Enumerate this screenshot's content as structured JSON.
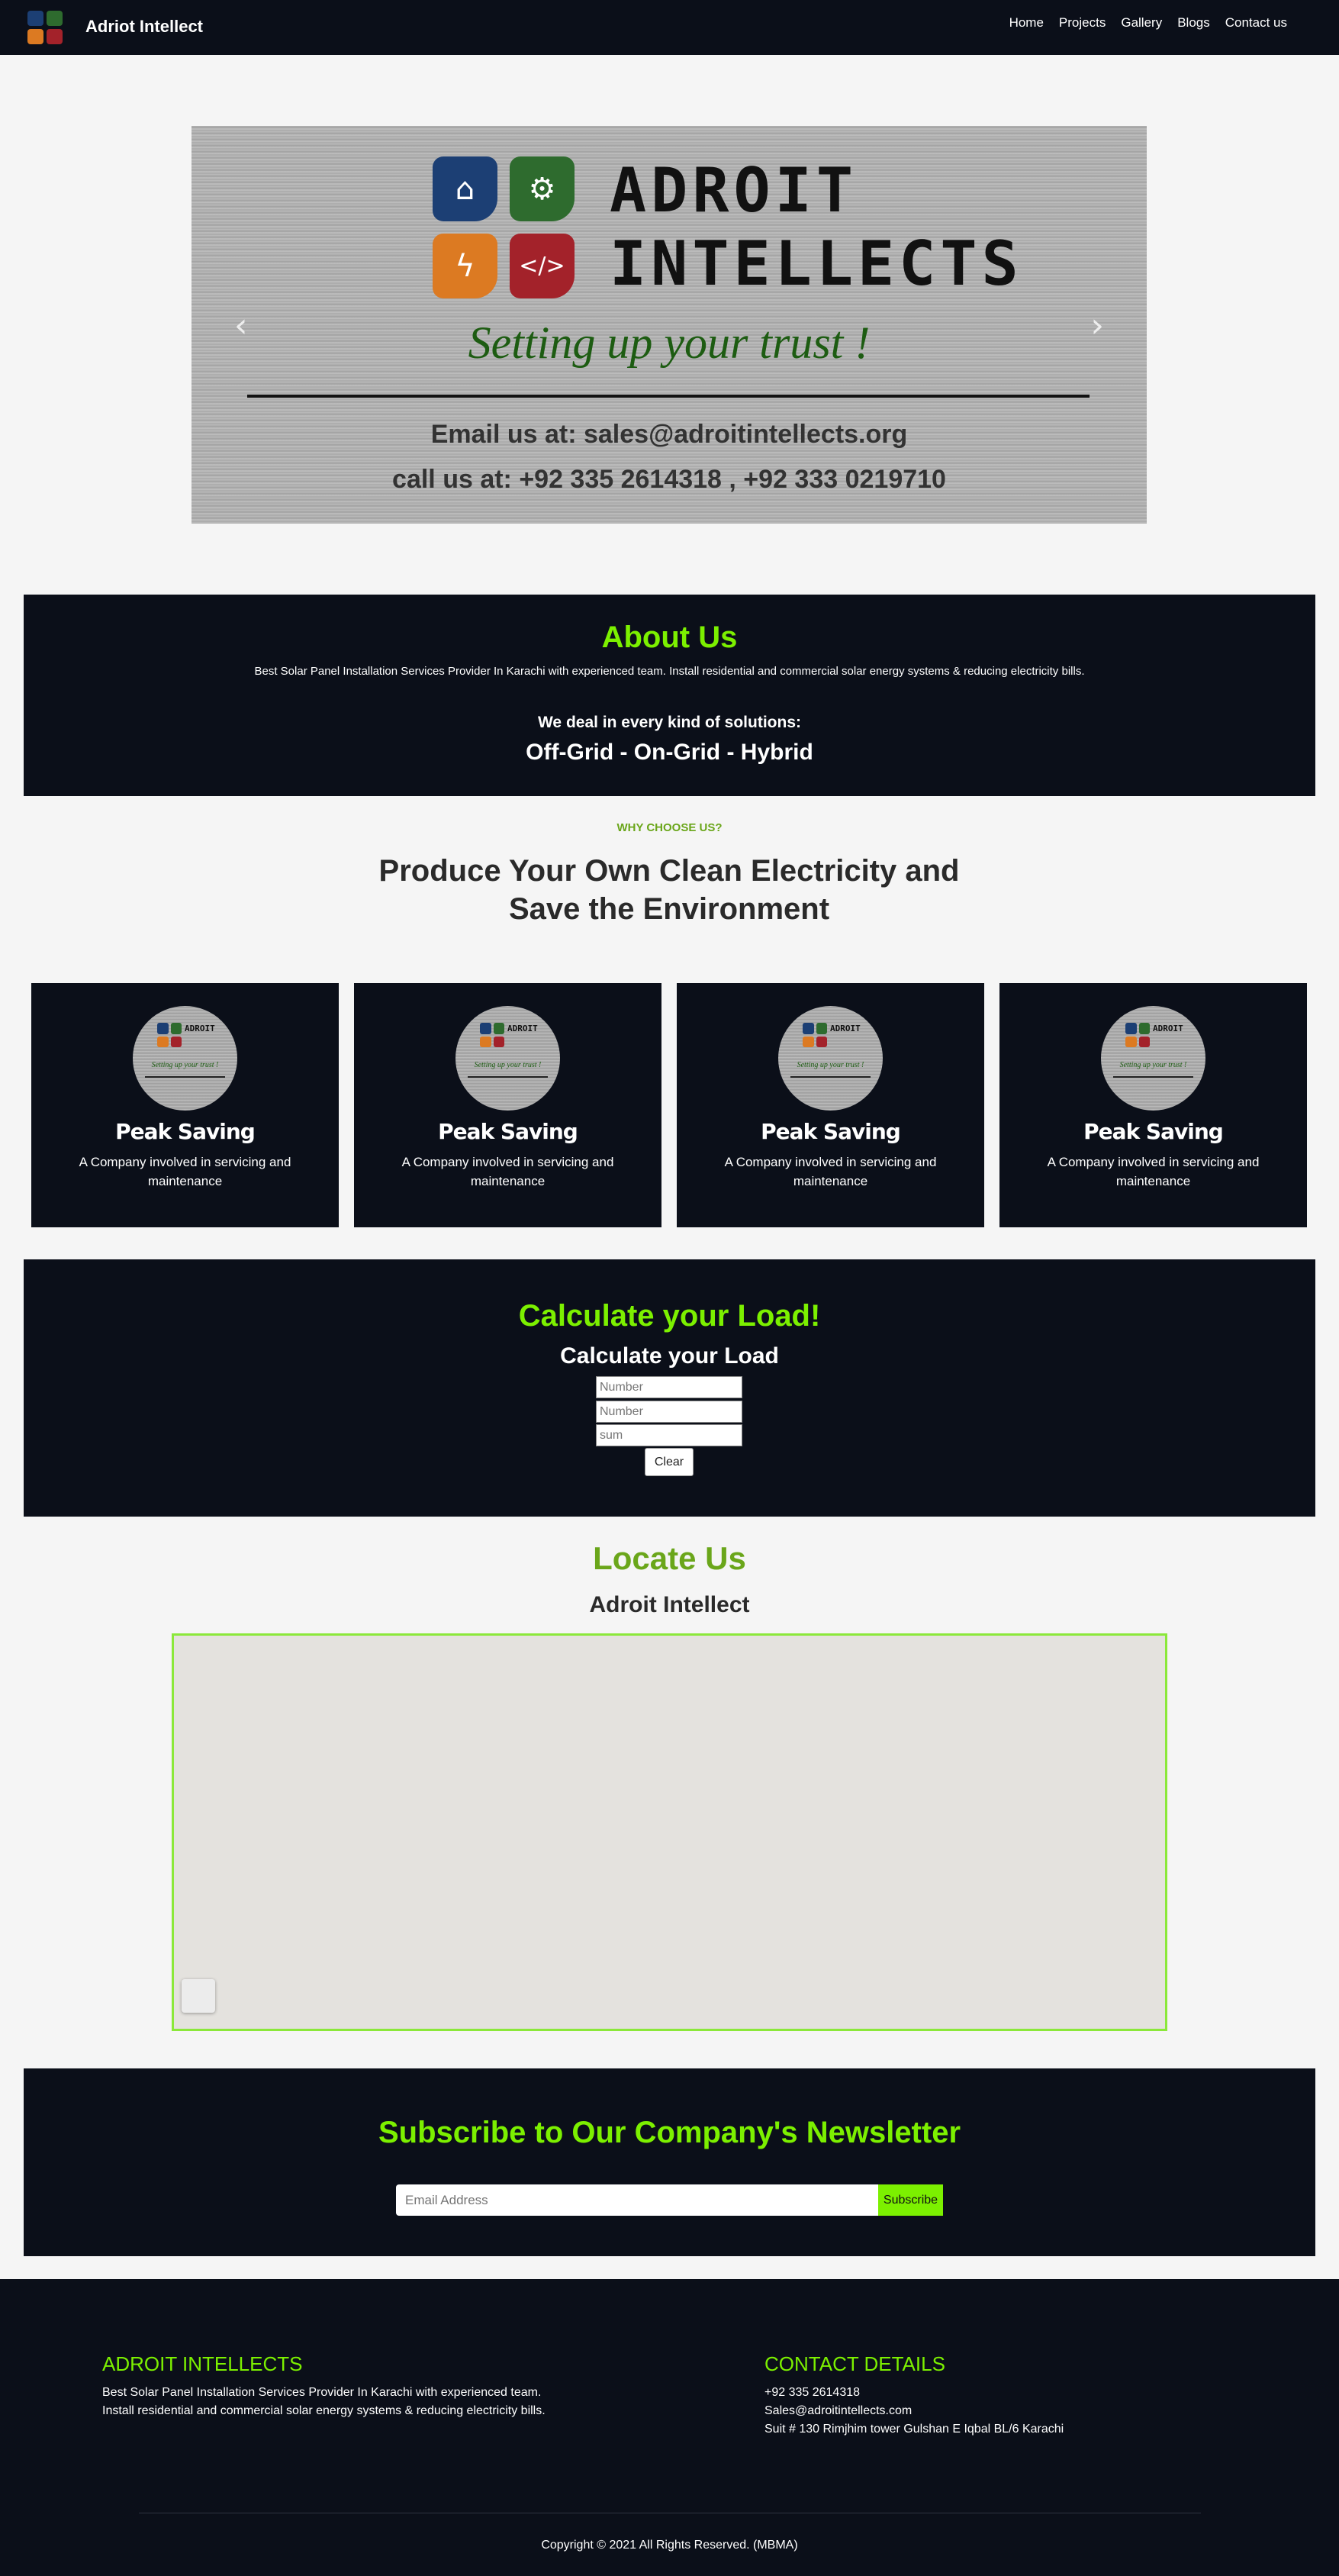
{
  "navbar": {
    "brand": "Adriot Intellect",
    "links": [
      "Home",
      "Projects",
      "Gallery",
      "Blogs",
      "Contact us"
    ]
  },
  "carousel": {
    "logo_line1": "ADROIT",
    "logo_line2": "INTELLECTS",
    "tagline": "Setting up your trust !",
    "email_line": "Email us at: sales@adroitintellects.org",
    "call_line": "call us at: +92 335 2614318 , +92 333 0219710",
    "prev_icon": "chevron-left-icon",
    "next_icon": "chevron-right-icon",
    "tile_colors": [
      "#1c3f74",
      "#2e6b2e",
      "#dc7a22",
      "#a3222a"
    ]
  },
  "about": {
    "title": "About Us",
    "text": "Best Solar Panel Installation Services Provider In Karachi with experienced team. Install residential and commercial solar energy systems & reducing electricity bills.",
    "subheading": "We deal in every kind of solutions:",
    "types": "Off-Grid - On-Grid - Hybrid"
  },
  "why": {
    "kicker": "WHY CHOOSE US?",
    "title": "Produce Your Own Clean Electricity and Save the Environment"
  },
  "cards": [
    {
      "title": "Peak Saving",
      "text": "A Company involved in servicing and maintenance"
    },
    {
      "title": "Peak Saving",
      "text": "A Company involved in servicing and maintenance"
    },
    {
      "title": "Peak Saving",
      "text": "A Company involved in servicing and maintenance"
    },
    {
      "title": "Peak Saving",
      "text": "A Company involved in servicing and maintenance"
    }
  ],
  "calculator": {
    "title": "Calculate your Load!",
    "subtitle": "Calculate your Load",
    "input1_placeholder": "Number",
    "input2_placeholder": "Number",
    "sum_placeholder": "sum",
    "clear_label": "Clear"
  },
  "locate": {
    "title": "Locate Us",
    "subtitle": "Adroit Intellect"
  },
  "newsletter": {
    "title": "Subscribe to Our Company's Newsletter",
    "email_placeholder": "Email Address",
    "button_label": "Subscribe"
  },
  "footer": {
    "col1_heading": "ADROIT INTELLECTS",
    "col1_line1": "Best Solar Panel Installation Services Provider In Karachi with experienced team.",
    "col1_line2": "Install residential and commercial solar energy systems & reducing electricity bills.",
    "col2_heading": "CONTACT DETAILS",
    "phone": "+92 335 2614318",
    "email": "Sales@adroitintellects.com",
    "address": "Suit # 130 Rimjhim tower Gulshan E Iqbal BL/6 Karachi",
    "copyright": "Copyright © 2021 All Rights Reserved. (MBMA)"
  },
  "colors": {
    "dark": "#0b0f19",
    "accent_green": "#7cf000",
    "heading_green": "#6aa61a",
    "map_border": "#8be83a"
  }
}
